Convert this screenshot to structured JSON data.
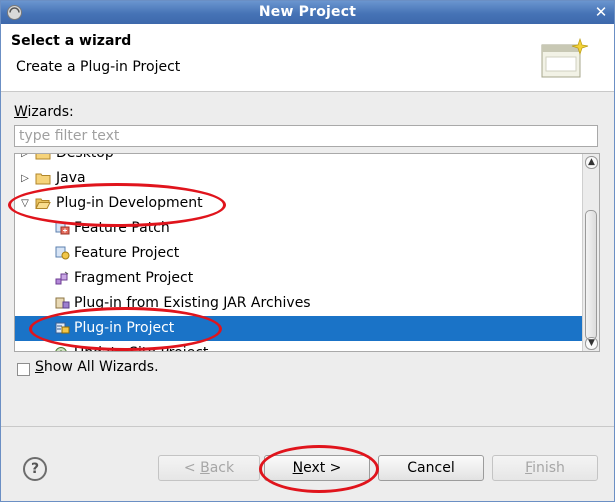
{
  "window": {
    "title": "New Project"
  },
  "header": {
    "title": "Select a wizard",
    "description": "Create a Plug-in Project"
  },
  "wizards": {
    "label": "Wizards:",
    "filter_placeholder": "type filter text",
    "tree": [
      {
        "label": "Desktop",
        "icon": "folder-icon",
        "twisty": "collapsed"
      },
      {
        "label": "Java",
        "icon": "folder-icon",
        "twisty": "collapsed"
      },
      {
        "label": "Plug-in Development",
        "icon": "folder-open-icon",
        "twisty": "expanded"
      },
      {
        "label": "Feature Patch",
        "icon": "feature-patch-icon"
      },
      {
        "label": "Feature Project",
        "icon": "feature-project-icon"
      },
      {
        "label": "Fragment Project",
        "icon": "fragment-project-icon"
      },
      {
        "label": "Plug-in from Existing JAR Archives",
        "icon": "plugin-jar-icon"
      },
      {
        "label": "Plug-in Project",
        "icon": "plugin-project-icon",
        "selected": true
      },
      {
        "label": "Update Site Project",
        "icon": "update-site-icon"
      }
    ]
  },
  "show_all": {
    "label": "Show All Wizards.",
    "checked": false
  },
  "buttons": {
    "help": "?",
    "back": "< Back",
    "next": "Next >",
    "cancel": "Cancel",
    "finish": "Finish"
  },
  "colors": {
    "selection": "#1a73c7",
    "annotation": "#e0141c",
    "titlebar": "#4673b6"
  }
}
